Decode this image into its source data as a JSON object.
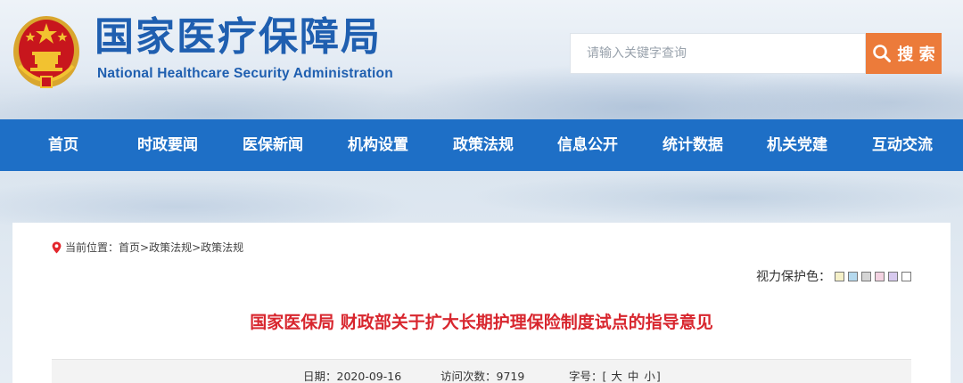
{
  "header": {
    "title": "国家医疗保障局",
    "subtitle": "National Healthcare Security Administration",
    "search": {
      "placeholder": "请输入关键字查询",
      "value": "",
      "button_label": "搜 索"
    }
  },
  "nav": {
    "items": [
      {
        "label": "首页"
      },
      {
        "label": "时政要闻"
      },
      {
        "label": "医保新闻"
      },
      {
        "label": "机构设置"
      },
      {
        "label": "政策法规"
      },
      {
        "label": "信息公开"
      },
      {
        "label": "统计数据"
      },
      {
        "label": "机关党建"
      },
      {
        "label": "互动交流"
      }
    ]
  },
  "breadcrumb": {
    "prefix": "当前位置：",
    "items": [
      "首页",
      "政策法规",
      "政策法规"
    ],
    "separator": ">"
  },
  "eye_care": {
    "label": "视力保护色：",
    "colors": [
      "#f5f0c8",
      "#b5d9ee",
      "#d5d5d5",
      "#f3d2e1",
      "#d7c9ee",
      "#ffffff"
    ]
  },
  "article": {
    "title": "国家医保局 财政部关于扩大长期护理保险制度试点的指导意见",
    "date_label": "日期：",
    "date": "2020-09-16",
    "visits_label": "访问次数：",
    "visits": "9719",
    "font_size_label": "字号：",
    "font_size_open": "[",
    "font_sizes": [
      "大",
      "中",
      "小"
    ],
    "font_size_close": "]"
  },
  "colors": {
    "brand_blue": "#1e6fc6",
    "title_blue": "#1f5fb0",
    "search_orange": "#ec7b3a",
    "headline_red": "#d8262e"
  }
}
